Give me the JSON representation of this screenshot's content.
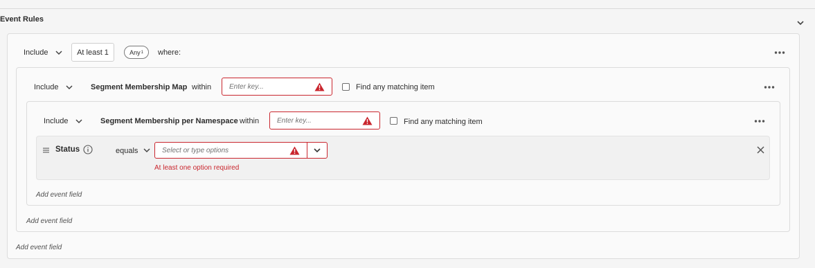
{
  "section": {
    "title": "Event Rules"
  },
  "outer": {
    "include_label": "Include",
    "count_label": "At least 1",
    "any_label": "Any",
    "any_sup": "1",
    "where_label": "where:",
    "add_field": "Add event field"
  },
  "mid": {
    "include_label": "Include",
    "field_name": "Segment Membership Map",
    "within_label": "within",
    "key_placeholder": "Enter key...",
    "find_any_label": "Find any matching item",
    "add_field": "Add event field"
  },
  "inner": {
    "include_label": "Include",
    "field_name": "Segment Membership per Namespace",
    "within_label": "within",
    "key_placeholder": "Enter key...",
    "find_any_label": "Find any matching item",
    "add_field": "Add event field"
  },
  "status_field": {
    "label": "Status",
    "operator": "equals",
    "placeholder": "Select or type options",
    "error": "At least one option required"
  },
  "colors": {
    "error": "#c9252d",
    "border": "#dcdcdc",
    "panel": "#fafafa"
  },
  "icons": [
    "chevron-down-icon",
    "warning-icon",
    "info-icon",
    "drag-handle-icon",
    "more-icon",
    "close-icon"
  ]
}
